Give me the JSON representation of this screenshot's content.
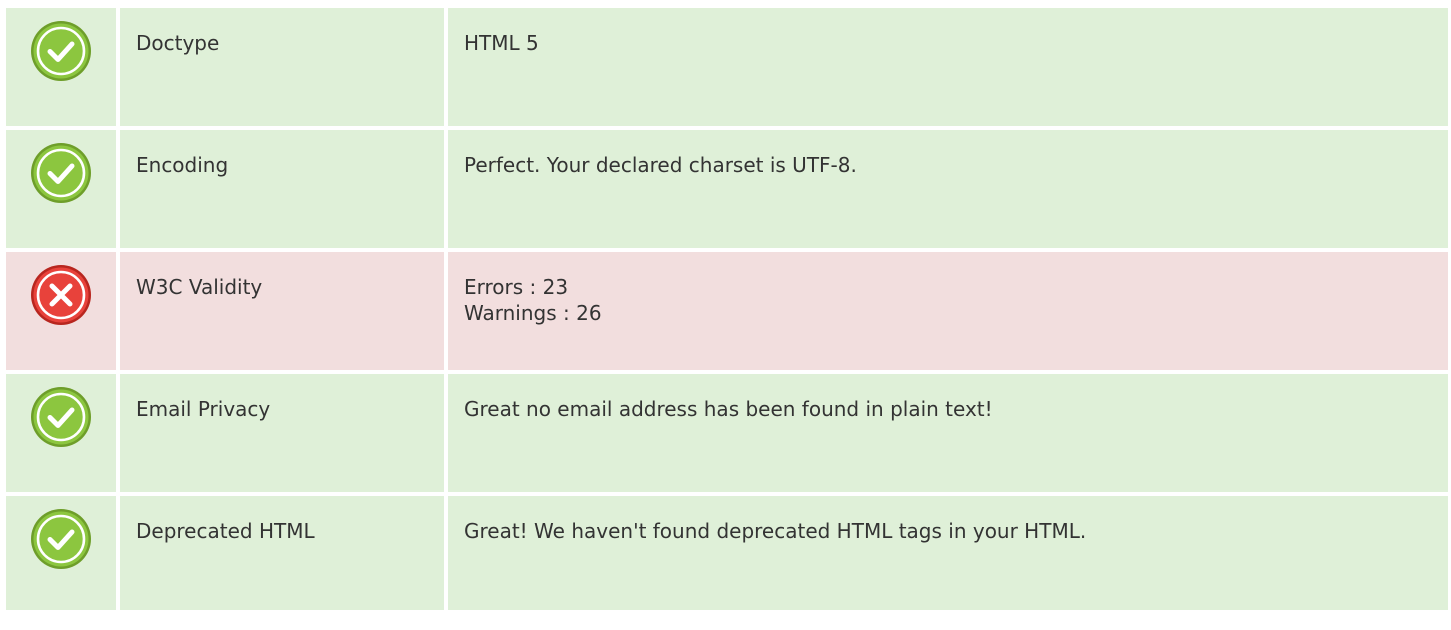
{
  "colors": {
    "pass_bg": "#dff0d8",
    "fail_bg": "#f2dede",
    "pass_icon": "#8cc63f",
    "fail_icon": "#e8423b"
  },
  "rows": [
    {
      "status": "pass",
      "icon": "check-circle-icon",
      "label": "Doctype",
      "lines": [
        "HTML 5"
      ]
    },
    {
      "status": "pass",
      "icon": "check-circle-icon",
      "label": "Encoding",
      "lines": [
        "Perfect. Your declared charset is UTF-8."
      ]
    },
    {
      "status": "fail",
      "icon": "cross-circle-icon",
      "label": "W3C Validity",
      "lines": [
        "Errors : 23",
        "Warnings : 26"
      ]
    },
    {
      "status": "pass",
      "icon": "check-circle-icon",
      "label": "Email Privacy",
      "lines": [
        "Great no email address has been found in plain text!"
      ]
    },
    {
      "status": "pass",
      "icon": "check-circle-icon",
      "label": "Deprecated HTML",
      "lines": [
        "Great! We haven't found deprecated HTML tags in your HTML."
      ]
    }
  ]
}
